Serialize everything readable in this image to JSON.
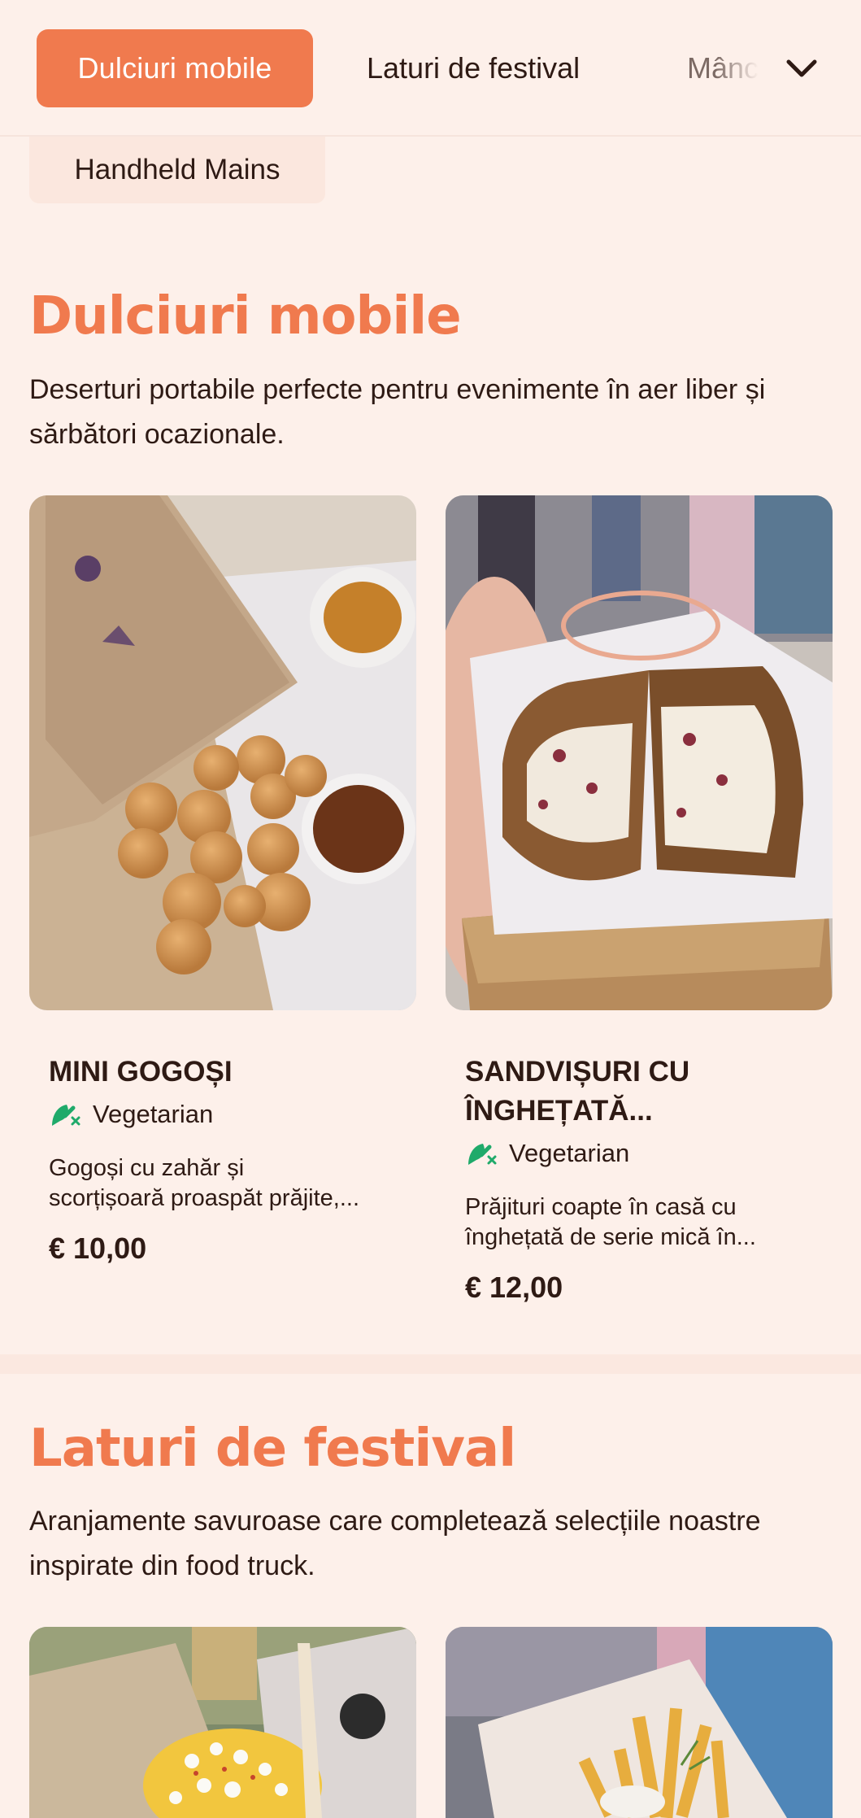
{
  "nav": {
    "active": "Dulciuri mobile",
    "second": "Laturi de festival",
    "third_partial": "Mânc",
    "row2": "Handheld Mains",
    "chevron_icon": "chevron-down-icon"
  },
  "sections": [
    {
      "title": "Dulciuri mobile",
      "description": "Deserturi portabile perfecte pentru evenimente în aer liber și sărbători ocazionale.",
      "items": [
        {
          "name": "MINI GOGOȘI",
          "tag": "Vegetarian",
          "description_line1": "Gogoși cu zahăr și",
          "description_line2": "scorțișoară proaspăt prăjite,...",
          "price": "€ 10,00"
        },
        {
          "name_line1": "SANDVIȘURI CU",
          "name_line2": "ÎNGHEȚATĂ...",
          "tag": "Vegetarian",
          "description_line1": "Prăjituri coapte în casă cu",
          "description_line2": "înghețată de serie mică în...",
          "price": "€ 12,00"
        }
      ]
    },
    {
      "title": "Laturi de festival",
      "description": "Aranjamente savuroase care completează selecțiile noastre inspirate din food truck."
    }
  ],
  "colors": {
    "accent": "#f07a4e",
    "background": "#fdf0ea",
    "veg_icon": "#1faa6a",
    "text": "#2e1a14"
  }
}
